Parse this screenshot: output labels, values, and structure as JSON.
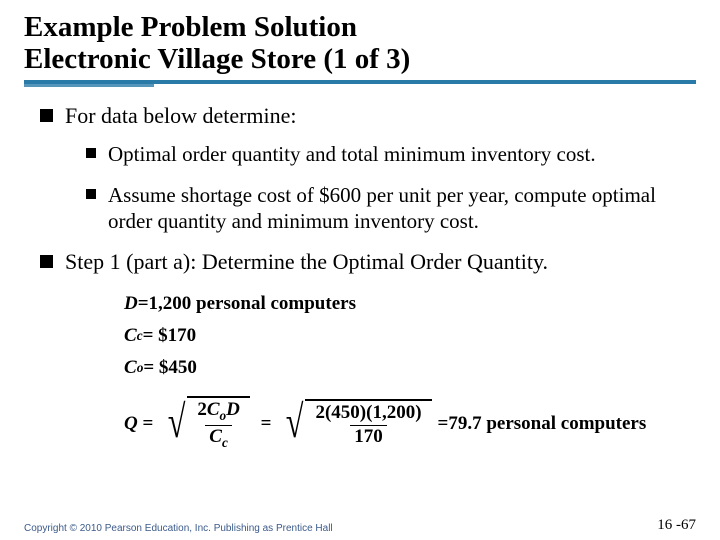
{
  "title_line1": "Example Problem Solution",
  "title_line2": "Electronic Village Store (1 of 3)",
  "bullets": {
    "b1": "For data below determine:",
    "b1a": "Optimal order quantity and total minimum inventory cost.",
    "b1b": "Assume shortage cost of $600 per unit per year, compute optimal order quantity  and minimum inventory cost.",
    "b2": "Step 1 (part a): Determine the Optimal Order Quantity."
  },
  "math": {
    "D_label": "D",
    "D_val": "=1,200 personal computers",
    "Cc_label": "C",
    "Cc_sub": "c",
    "Cc_val": " =  $170",
    "Co_label": "C",
    "Co_sub": "o",
    "Co_val": " = $450",
    "Q_label": "Q",
    "num1_a": "2",
    "num1_b": "C",
    "num1_b_sub": "o",
    "num1_c": "D",
    "den1": "C",
    "den1_sub": "c",
    "num2": "2(450)(1,200)",
    "den2": "170",
    "result": "=79.7 personal computers"
  },
  "footer": {
    "copyright": "Copyright © 2010 Pearson Education, Inc. Publishing as Prentice Hall",
    "page": "16 -67"
  }
}
